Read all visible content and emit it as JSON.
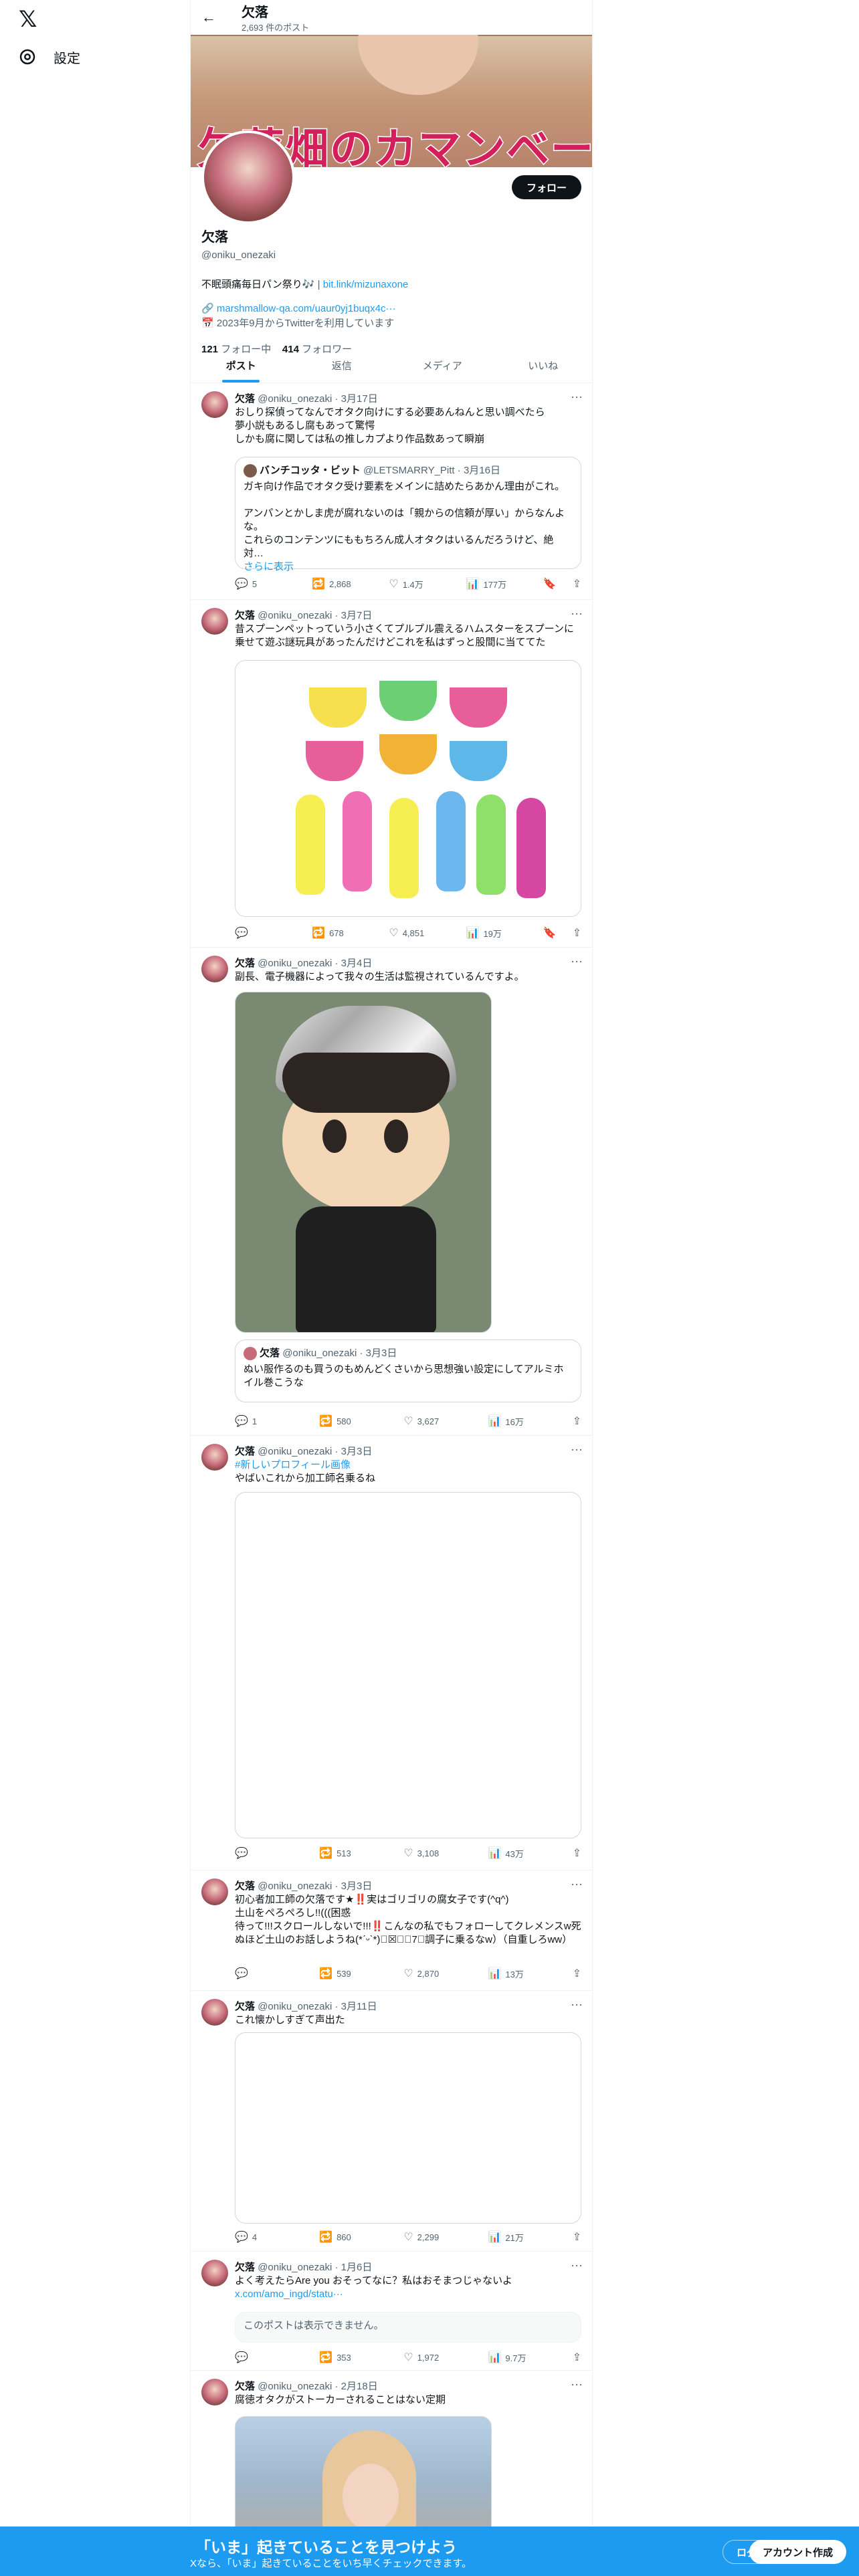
{
  "nav": {
    "settings_label": "設定"
  },
  "header": {
    "name": "欠落",
    "post_count": "2,693 件のポスト"
  },
  "banner": {
    "title": "欠落畑のカマンベール"
  },
  "profile": {
    "follow_label": "フォロー",
    "name": "欠落",
    "handle": "@oniku_onezaki",
    "bio": "不眠頭痛毎日パン祭り🎶",
    "bio_link": "bit.link/mizunaxone",
    "link": "marshmallow-qa.com/uaur0yj1buqx4c···",
    "joined": "2023年9月からTwitterを利用しています",
    "following_count": "121",
    "following_label": "フォロー中",
    "followers_count": "414",
    "followers_label": "フォロワー"
  },
  "tabs": [
    "ポスト",
    "返信",
    "メディア",
    "いいね"
  ],
  "posts": [
    {
      "name": "欠落",
      "handle": "@oniku_onezaki",
      "date": "3月17日",
      "text": "おしり探偵ってなんでオタク向けにする必要あんねんと思い調べたら\n夢小説もあるし腐もあって驚愕\nしかも腐に関しては私の推しカプより作品数あって瞬崩",
      "quote": {
        "name": "バンチコッタ・ビット",
        "handle": "@LETSMARRY_Pitt",
        "date": "3月16日",
        "text": "ガキ向け作品でオタク受け要素をメインに詰めたらあかん理由がこれ。\n\nアンパンとかしま虎が腐れないのは「親からの信頼が厚い」からなんよな。\nこれらのコンテンツにももちろん成人オタクはいるんだろうけど、絶対…",
        "more": "さらに表示"
      },
      "replies": "5",
      "reposts": "2,868",
      "likes": "1.4万",
      "views": "177万"
    },
    {
      "name": "欠落",
      "handle": "@oniku_onezaki",
      "date": "3月7日",
      "text": "昔スプーンペットっていう小さくてプルプル震えるハムスターをスプーンに乗せて遊ぶ謎玩具があったんだけどこれを私はずっと股間に当ててた",
      "replies": "",
      "reposts": "678",
      "likes": "4,851",
      "views": "19万"
    },
    {
      "name": "欠落",
      "handle": "@oniku_onezaki",
      "date": "3月4日",
      "text": "副長、電子機器によって我々の生活は監視されているんですよ。",
      "quote": {
        "name": "欠落",
        "handle": "@oniku_onezaki",
        "date": "3月3日",
        "text": "ぬい服作るのも買うのもめんどくさいから思想強い設定にしてアルミホイル巻こうな"
      },
      "replies": "1",
      "reposts": "580",
      "likes": "3,627",
      "views": "16万"
    },
    {
      "name": "欠落",
      "handle": "@oniku_onezaki",
      "date": "3月3日",
      "hashtag": "#新しいプロフィール画像",
      "text": "やばいこれから加工師名乗るね",
      "replies": "",
      "reposts": "513",
      "likes": "3,108",
      "views": "43万"
    },
    {
      "name": "欠落",
      "handle": "@oniku_onezaki",
      "date": "3月3日",
      "text": "初心者加工師の欠落です★‼️実はゴリゴリの腐女子です(^q^)\n土山をぺろぺろし!!(((困惑\n待って!!!スクロールしないで!!!‼️こんなの私でもフォローしてクレメンスw死ぬほど土山のお話しようね(*ˊᵕˋ*)ﾟ☒☒ﾟ7（調子に乗るなw）（自重しろww）",
      "replies": "",
      "reposts": "539",
      "likes": "2,870",
      "views": "13万"
    },
    {
      "name": "欠落",
      "handle": "@oniku_onezaki",
      "date": "3月11日",
      "text": "これ懐かしすぎて声出た",
      "replies": "4",
      "reposts": "860",
      "likes": "2,299",
      "views": "21万"
    },
    {
      "name": "欠落",
      "handle": "@oniku_onezaki",
      "date": "1月6日",
      "text": "よく考えたらAre you おそってなに？私はおそまつじゃないよ",
      "link": "x.com/amo_ingd/statu···",
      "unavailable": "このポストは表示できません。",
      "replies": "",
      "reposts": "353",
      "likes": "1,972",
      "views": "9.7万"
    },
    {
      "name": "欠落",
      "handle": "@oniku_onezaki",
      "date": "2月18日",
      "text": "腐徳オタクがストーカーされることはない定期"
    }
  ],
  "footer": {
    "title": "「いま」起きていることを見つけよう",
    "subtitle": "Xなら、「いま」起きていることをいち早くチェックできます。",
    "login": "ログイン",
    "signup": "アカウント作成"
  }
}
